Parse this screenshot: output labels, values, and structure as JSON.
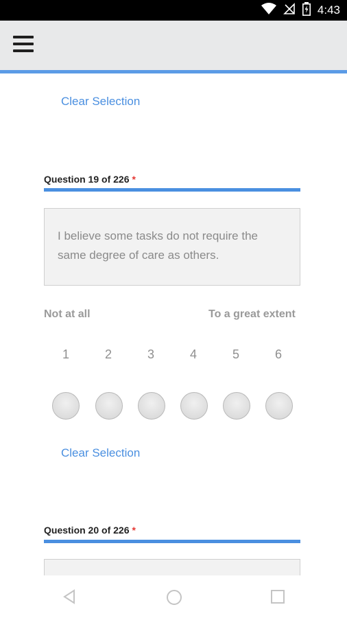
{
  "status": {
    "time": "4:43"
  },
  "app": {
    "menu_icon": "hamburger-menu-icon"
  },
  "questions": [
    {
      "title": "Question 19 of 226",
      "required_mark": "*",
      "text": "I believe some tasks do not require the same degree of care as others.",
      "scale_low": "Not at all",
      "scale_high": "To a great extent",
      "options": [
        "1",
        "2",
        "3",
        "4",
        "5",
        "6"
      ]
    },
    {
      "title": "Question 20 of 226",
      "required_mark": "*"
    }
  ],
  "clear_selection_label": "Clear Selection",
  "colors": {
    "accent": "#4a8fe0",
    "required": "#e53935",
    "appbar": "#e8e9ea"
  },
  "nav": {
    "back_icon": "back-triangle-icon",
    "home_icon": "home-circle-icon",
    "recents_icon": "recents-square-icon"
  }
}
